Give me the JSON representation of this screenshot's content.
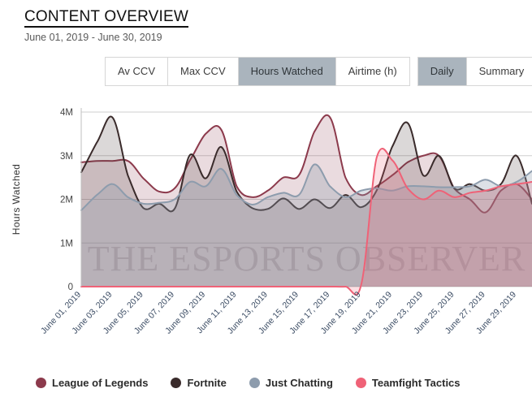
{
  "header": {
    "title": "CONTENT OVERVIEW",
    "date_range": "June 01, 2019 - June 30, 2019"
  },
  "metric_tabs": [
    {
      "label": "Av CCV",
      "active": false
    },
    {
      "label": "Max CCV",
      "active": false
    },
    {
      "label": "Hours Watched",
      "active": true
    },
    {
      "label": "Airtime (h)",
      "active": false
    }
  ],
  "view_tabs": [
    {
      "label": "Daily",
      "active": true
    },
    {
      "label": "Summary",
      "active": false
    }
  ],
  "watermark": "THE ESPORTS OBSERVER",
  "legend": [
    {
      "label": "League of Legends",
      "color": "#8c3a4c"
    },
    {
      "label": "Fortnite",
      "color": "#3a2b2b"
    },
    {
      "label": "Just Chatting",
      "color": "#8d9cad"
    },
    {
      "label": "Teamfight Tactics",
      "color": "#ef6277"
    }
  ],
  "chart_data": {
    "type": "area",
    "title": "",
    "xlabel": "",
    "ylabel": "Hours Watched",
    "ylim": [
      0,
      4000000
    ],
    "ytick_values": [
      0,
      1000000,
      2000000,
      3000000,
      4000000
    ],
    "ytick_labels": [
      "0",
      "1M",
      "2M",
      "3M",
      "4M"
    ],
    "grid": true,
    "legend_position": "bottom",
    "x": [
      "June 01, 2019",
      "June 02, 2019",
      "June 03, 2019",
      "June 04, 2019",
      "June 05, 2019",
      "June 06, 2019",
      "June 07, 2019",
      "June 08, 2019",
      "June 09, 2019",
      "June 10, 2019",
      "June 11, 2019",
      "June 12, 2019",
      "June 13, 2019",
      "June 14, 2019",
      "June 15, 2019",
      "June 16, 2019",
      "June 17, 2019",
      "June 18, 2019",
      "June 19, 2019",
      "June 20, 2019",
      "June 21, 2019",
      "June 22, 2019",
      "June 23, 2019",
      "June 24, 2019",
      "June 25, 2019",
      "June 26, 2019",
      "June 27, 2019",
      "June 28, 2019",
      "June 29, 2019",
      "June 30, 2019"
    ],
    "xtick_labels": [
      "June 01, 2019",
      "June 03, 2019",
      "June 05, 2019",
      "June 07, 2019",
      "June 09, 2019",
      "June 11, 2019",
      "June 13, 2019",
      "June 15, 2019",
      "June 17, 2019",
      "June 19, 2019",
      "June 21, 2019",
      "June 23, 2019",
      "June 25, 2019",
      "June 27, 2019",
      "June 29, 2019"
    ],
    "series": [
      {
        "name": "League of Legends",
        "color": "#8c3a4c",
        "fill": "#8c3a4c",
        "fill_opacity": 0.18,
        "values": [
          2850000,
          2880000,
          2880000,
          2880000,
          2480000,
          2180000,
          2250000,
          2900000,
          3500000,
          3600000,
          2300000,
          2050000,
          2200000,
          2500000,
          2550000,
          3550000,
          3880000,
          2500000,
          2100000,
          2300000,
          2550000,
          2850000,
          3000000,
          3000000,
          2250000,
          2000000,
          1700000,
          2200000,
          2350000,
          2000000
        ]
      },
      {
        "name": "Fortnite",
        "color": "#3a2b2b",
        "fill": "#4a3b3b",
        "fill_opacity": 0.2,
        "values": [
          2620000,
          3300000,
          3880000,
          2550000,
          1800000,
          1900000,
          1780000,
          3020000,
          2480000,
          3200000,
          2180000,
          1800000,
          1780000,
          2020000,
          1780000,
          2000000,
          1800000,
          2100000,
          1820000,
          2200000,
          3200000,
          3750000,
          2550000,
          3000000,
          2250000,
          2350000,
          2200000,
          2350000,
          3000000,
          1900000
        ]
      },
      {
        "name": "Just Chatting",
        "color": "#8d9cad",
        "fill": "#8d9cad",
        "fill_opacity": 0.3,
        "values": [
          1750000,
          2100000,
          2350000,
          2050000,
          1900000,
          1920000,
          2000000,
          2400000,
          2300000,
          2700000,
          2100000,
          1880000,
          2050000,
          2150000,
          2100000,
          2800000,
          2300000,
          2050000,
          2200000,
          2250000,
          2200000,
          2300000,
          2300000,
          2280000,
          2280000,
          2300000,
          2450000,
          2300000,
          2400000,
          2650000
        ]
      },
      {
        "name": "Teamfight Tactics",
        "color": "#ef6277",
        "fill": "#ef6277",
        "fill_opacity": 0.2,
        "values": [
          0,
          0,
          0,
          0,
          0,
          0,
          0,
          0,
          0,
          0,
          0,
          0,
          0,
          0,
          0,
          0,
          0,
          0,
          30000,
          2950000,
          2900000,
          2250000,
          2000000,
          2200000,
          2050000,
          2150000,
          2200000,
          2300000,
          2350000,
          2400000
        ]
      }
    ]
  }
}
